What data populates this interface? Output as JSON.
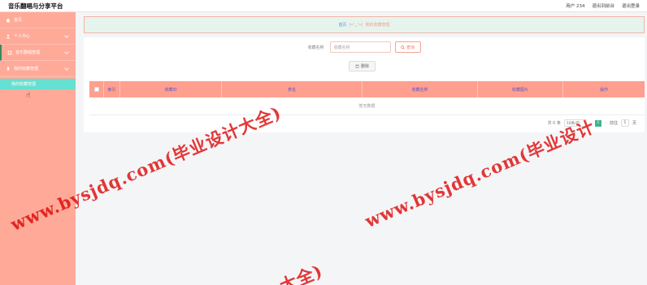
{
  "app": {
    "title": "音乐翻唱与分享平台"
  },
  "topbar": {
    "user": "用户 234",
    "back_admin": "退出到前台",
    "logout": "退出登录"
  },
  "sidebar": {
    "items": [
      {
        "label": "首页"
      },
      {
        "label": "个人中心"
      },
      {
        "label": "音乐翻唱管理"
      },
      {
        "label": "我的收藏管理"
      }
    ],
    "sub_item": "我的收藏管理"
  },
  "breadcrumb": {
    "home": "首页",
    "face": "(•'◡'•)",
    "current": "我的收藏管理"
  },
  "search": {
    "label": "收藏名称",
    "placeholder": "收藏名称",
    "button": "查询"
  },
  "actions": {
    "delete": "删除"
  },
  "table": {
    "columns": [
      "索引",
      "收藏ID",
      "表名",
      "收藏名称",
      "收藏图片",
      "操作"
    ],
    "empty_text": "暂无数据"
  },
  "pagination": {
    "total": "共 0 条",
    "page_size": "10条/页",
    "prev": "‹",
    "current_page": "1",
    "next": "›",
    "goto_label": "前往",
    "goto_value": "1",
    "page_unit": "页"
  },
  "watermark": {
    "text1": "www.bysjdq.com(毕业设计大全)",
    "text2": "www.bysjdq.com(毕业设计",
    "text3": "大全)"
  },
  "colors": {
    "sidebar": "#ffaa99",
    "table_header": "#ff9f8f",
    "active_sub": "#66e0d2",
    "page_active": "#3fb58a",
    "watermark": "#dc0000"
  }
}
